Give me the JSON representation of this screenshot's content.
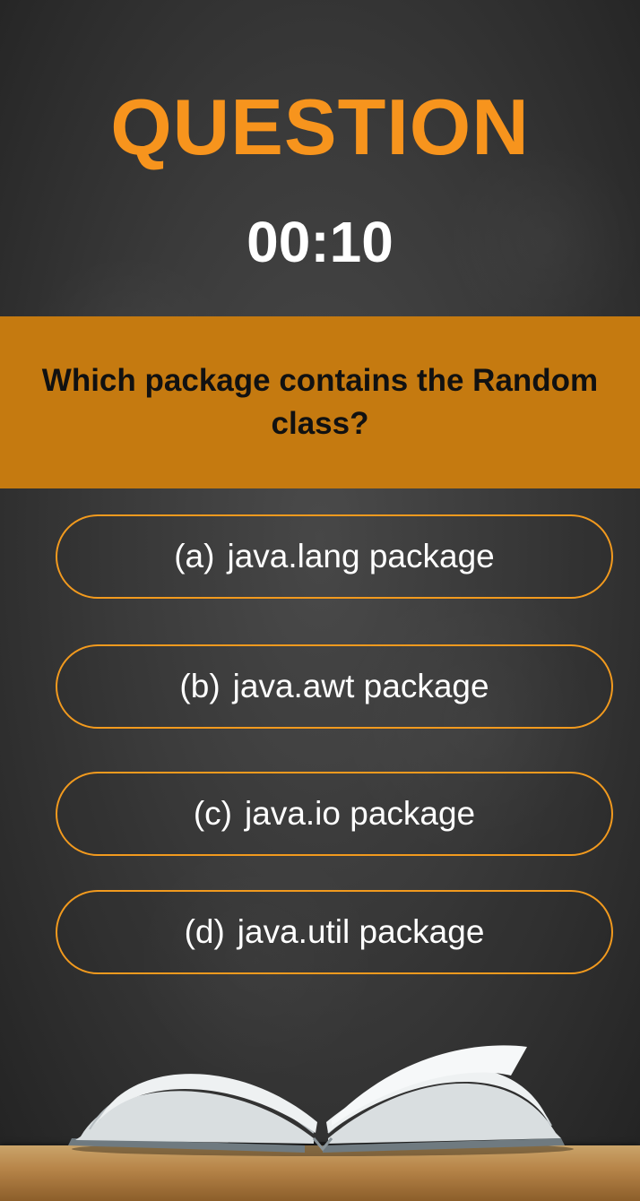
{
  "screen": {
    "title": "QUESTION",
    "timer": "00:10",
    "question": "Which package contains the Random class?",
    "options": [
      {
        "letter": "(a)",
        "text": "java.lang package"
      },
      {
        "letter": "(b)",
        "text": "java.awt package"
      },
      {
        "letter": "(c)",
        "text": "java.io package"
      },
      {
        "letter": "(d)",
        "text": "java.util package"
      }
    ]
  },
  "colors": {
    "accent": "#f7941d",
    "question_band": "#c57a10",
    "option_border": "#f29a1e",
    "background": "#3a3a3a"
  },
  "decor": {
    "icon": "open-book-icon"
  }
}
